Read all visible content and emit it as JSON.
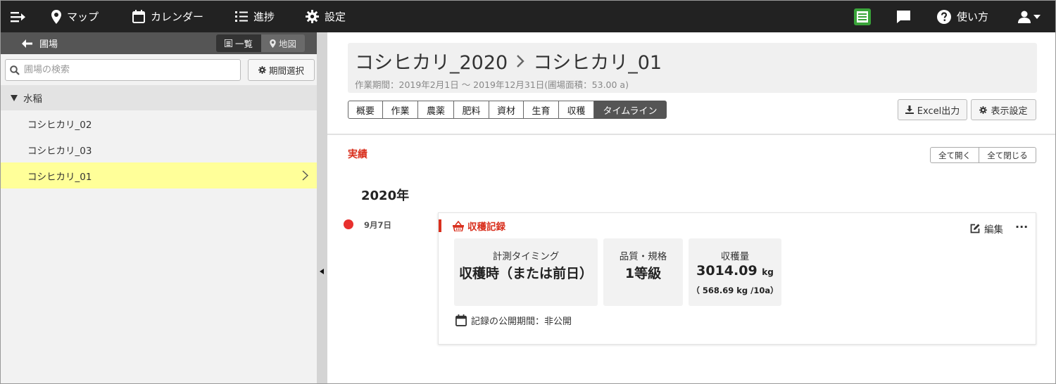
{
  "nav": {
    "map": "マップ",
    "calendar": "カレンダー",
    "progress": "進捗",
    "settings": "設定",
    "help": "使い方"
  },
  "sidebar": {
    "back_label": "圃場",
    "view_list": "一覧",
    "view_map": "地図",
    "search_placeholder": "圃場の検索",
    "period_button": "期間選択",
    "group_label": "水稲",
    "items": [
      {
        "label": "コシヒカリ_02",
        "selected": false
      },
      {
        "label": "コシヒカリ_03",
        "selected": false
      },
      {
        "label": "コシヒカリ_01",
        "selected": true
      }
    ]
  },
  "header": {
    "parent": "コシヒカリ_2020",
    "current": "コシヒカリ_01",
    "period": "作業期間：2019年2月1日 〜 2019年12月31日(圃場面積：53.00 a)"
  },
  "tabs": [
    "概要",
    "作業",
    "農薬",
    "肥料",
    "資材",
    "生育",
    "収穫",
    "タイムライン"
  ],
  "active_tab": "タイムライン",
  "toolbar": {
    "excel": "Excel出力",
    "display": "表示設定"
  },
  "timeline": {
    "section": "実績",
    "expand_all": "全て開く",
    "collapse_all": "全て閉じる",
    "year": "2020年",
    "entry": {
      "date": "9月7日",
      "title": "収穫記録",
      "edit": "編集",
      "more": "···",
      "boxes": [
        {
          "label": "計測タイミング",
          "value": "収穫時（または前日）"
        },
        {
          "label": "品質・規格",
          "value": "1等級"
        },
        {
          "label": "収穫量",
          "value": "3014.09",
          "unit": "kg",
          "sub": "（ 568.69 kg /10a）"
        }
      ],
      "public_period": "記録の公開期間：非公開"
    }
  },
  "colors": {
    "nav_bg": "#222222",
    "accent_red": "#d9301e",
    "selected_row": "#ffff99",
    "badge_green": "#3aa43a"
  }
}
